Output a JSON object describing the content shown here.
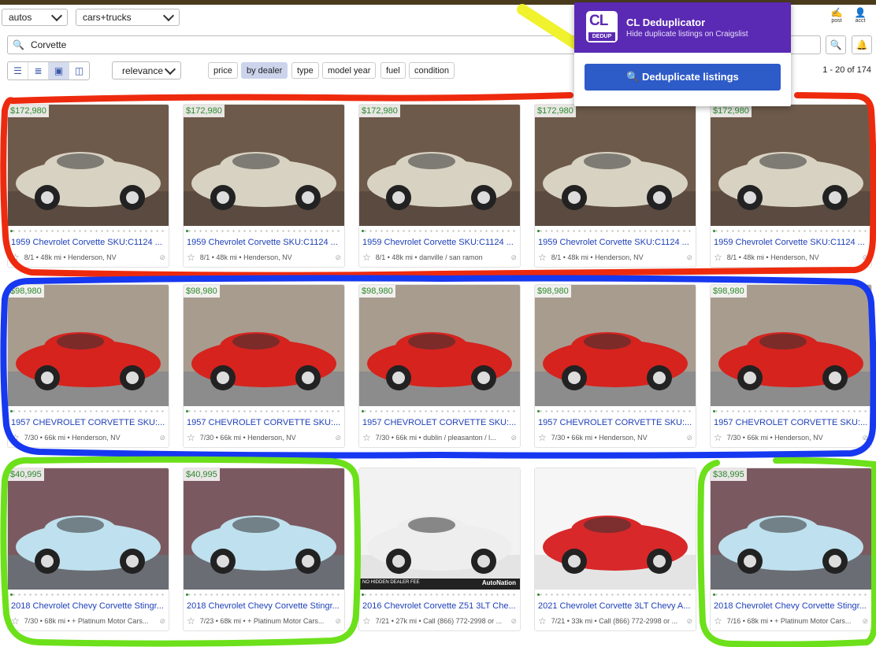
{
  "header": {
    "category_select": "autos",
    "subcategory_select": "cars+trucks",
    "post_label": "post",
    "acct_label": "acct"
  },
  "search": {
    "query": "Corvette"
  },
  "toolbar": {
    "sort": "relevance",
    "filters": [
      "price",
      "by dealer",
      "type",
      "model year",
      "fuel",
      "condition"
    ],
    "active_filter": "by dealer",
    "results_count": "1 - 20 of 174"
  },
  "extension": {
    "logo_text": "CL",
    "logo_sub": "DEDUP",
    "title": "CL Deduplicator",
    "subtitle": "Hide duplicate listings on Craigslist",
    "button_label": "🔍 Deduplicate listings"
  },
  "listings": [
    {
      "price": "$172,980",
      "title": "1959 Chevrolet Corvette SKU:C1124 ...",
      "meta": "8/1 • 48k mi • Henderson, NV",
      "color": "#d8d2c2"
    },
    {
      "price": "$172,980",
      "title": "1959 Chevrolet Corvette SKU:C1124 ...",
      "meta": "8/1 • 48k mi • Henderson, NV",
      "color": "#d8d2c2"
    },
    {
      "price": "$172,980",
      "title": "1959 Chevrolet Corvette SKU:C1124 ...",
      "meta": "8/1 • 48k mi • danville / san ramon",
      "color": "#d8d2c2"
    },
    {
      "price": "$172,980",
      "title": "1959 Chevrolet Corvette SKU:C1124 ...",
      "meta": "8/1 • 48k mi • Henderson, NV",
      "color": "#d8d2c2"
    },
    {
      "price": "$172,980",
      "title": "1959 Chevrolet Corvette SKU:C1124 ...",
      "meta": "8/1 • 48k mi • Henderson, NV",
      "color": "#d8d2c2"
    },
    {
      "price": "$98,980",
      "title": "1957 CHEVROLET CORVETTE SKU:...",
      "meta": "7/30 • 66k mi • Henderson, NV",
      "color": "#d6231e"
    },
    {
      "price": "$98,980",
      "title": "1957 CHEVROLET CORVETTE SKU:...",
      "meta": "7/30 • 66k mi • Henderson, NV",
      "color": "#d6231e"
    },
    {
      "price": "$98,980",
      "title": "1957 CHEVROLET CORVETTE SKU:...",
      "meta": "7/30 • 66k mi • dublin / pleasanton / l...",
      "color": "#d6231e"
    },
    {
      "price": "$98,980",
      "title": "1957 CHEVROLET CORVETTE SKU:...",
      "meta": "7/30 • 66k mi • Henderson, NV",
      "color": "#d6231e"
    },
    {
      "price": "$98,980",
      "title": "1957 CHEVROLET CORVETTE SKU:...",
      "meta": "7/30 • 66k mi • Henderson, NV",
      "color": "#d6231e"
    },
    {
      "price": "$40,995",
      "title": "2018 Chevrolet Chevy Corvette Stingr...",
      "meta": "7/30 • 68k mi • + Platinum Motor Cars...",
      "color": "#bfe0ee"
    },
    {
      "price": "$40,995",
      "title": "2018 Chevrolet Chevy Corvette Stingr...",
      "meta": "7/23 • 68k mi • + Platinum Motor Cars...",
      "color": "#bfe0ee"
    },
    {
      "price": "",
      "title": "2016 Chevrolet Corvette Z51 3LT Che...",
      "meta": "7/21 • 27k mi • Call (866) 772-2998 or ...",
      "color": "#eeeeee",
      "banner": "NO HIDDEN DEALER FEE",
      "brand": "AutoNation"
    },
    {
      "price": "",
      "title": "2021 Chevrolet Corvette 3LT Chevy A...",
      "meta": "7/21 • 33k mi • Call (866) 772-2998 or ...",
      "color": "#d8282a"
    },
    {
      "price": "$38,995",
      "title": "2018 Chevrolet Chevy Corvette Stingr...",
      "meta": "7/16 • 68k mi • + Platinum Motor Cars...",
      "color": "#bfe0ee"
    }
  ]
}
